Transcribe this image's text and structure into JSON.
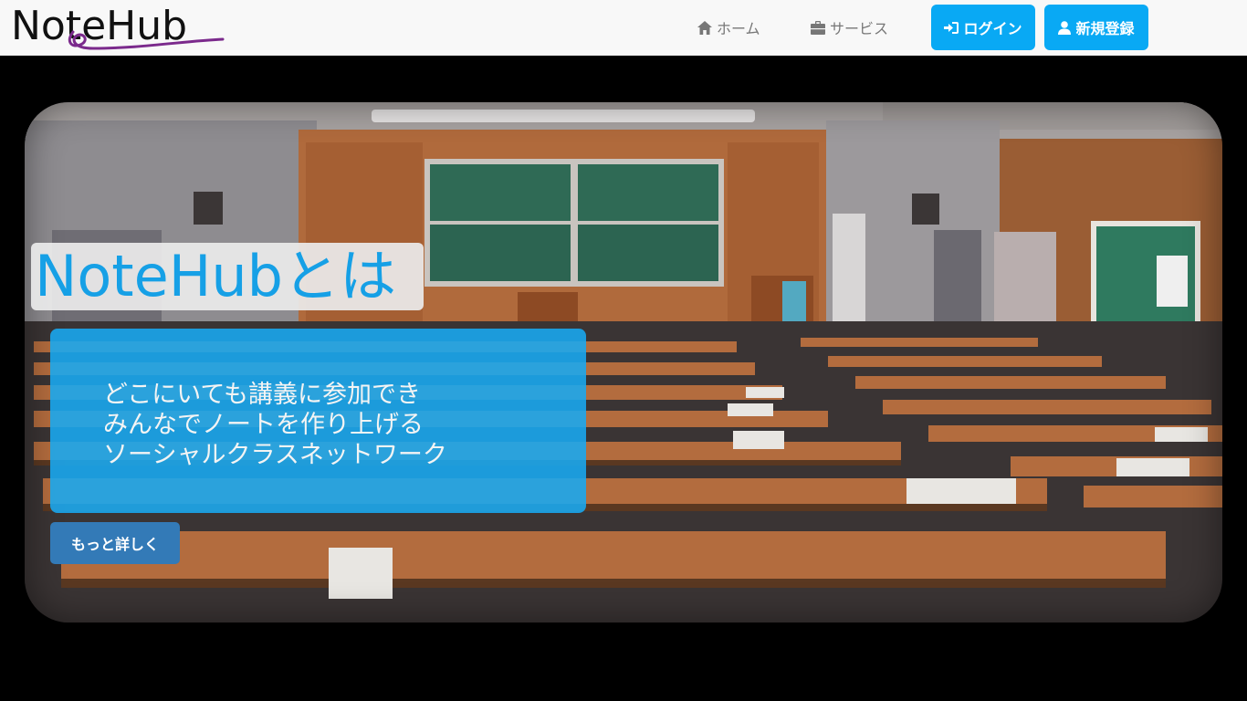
{
  "brand": {
    "logo_text": "NoteHub"
  },
  "nav": {
    "home": "ホーム",
    "services": "サービス",
    "login": "ログイン",
    "signup": "新規登録"
  },
  "hero": {
    "title": "NoteHubとは",
    "tagline_lines": [
      "どこにいても講義に参加でき",
      "みんなでノートを作り上げる",
      "ソーシャルクラスネットワーク"
    ],
    "more_button": "もっと詳しく",
    "background_image": "lecture-hall-photo"
  },
  "colors": {
    "accent": "#09a9f4",
    "more_button": "#337ab7",
    "title_text": "#16a0e6",
    "logo_swash": "#7b2a8c"
  }
}
